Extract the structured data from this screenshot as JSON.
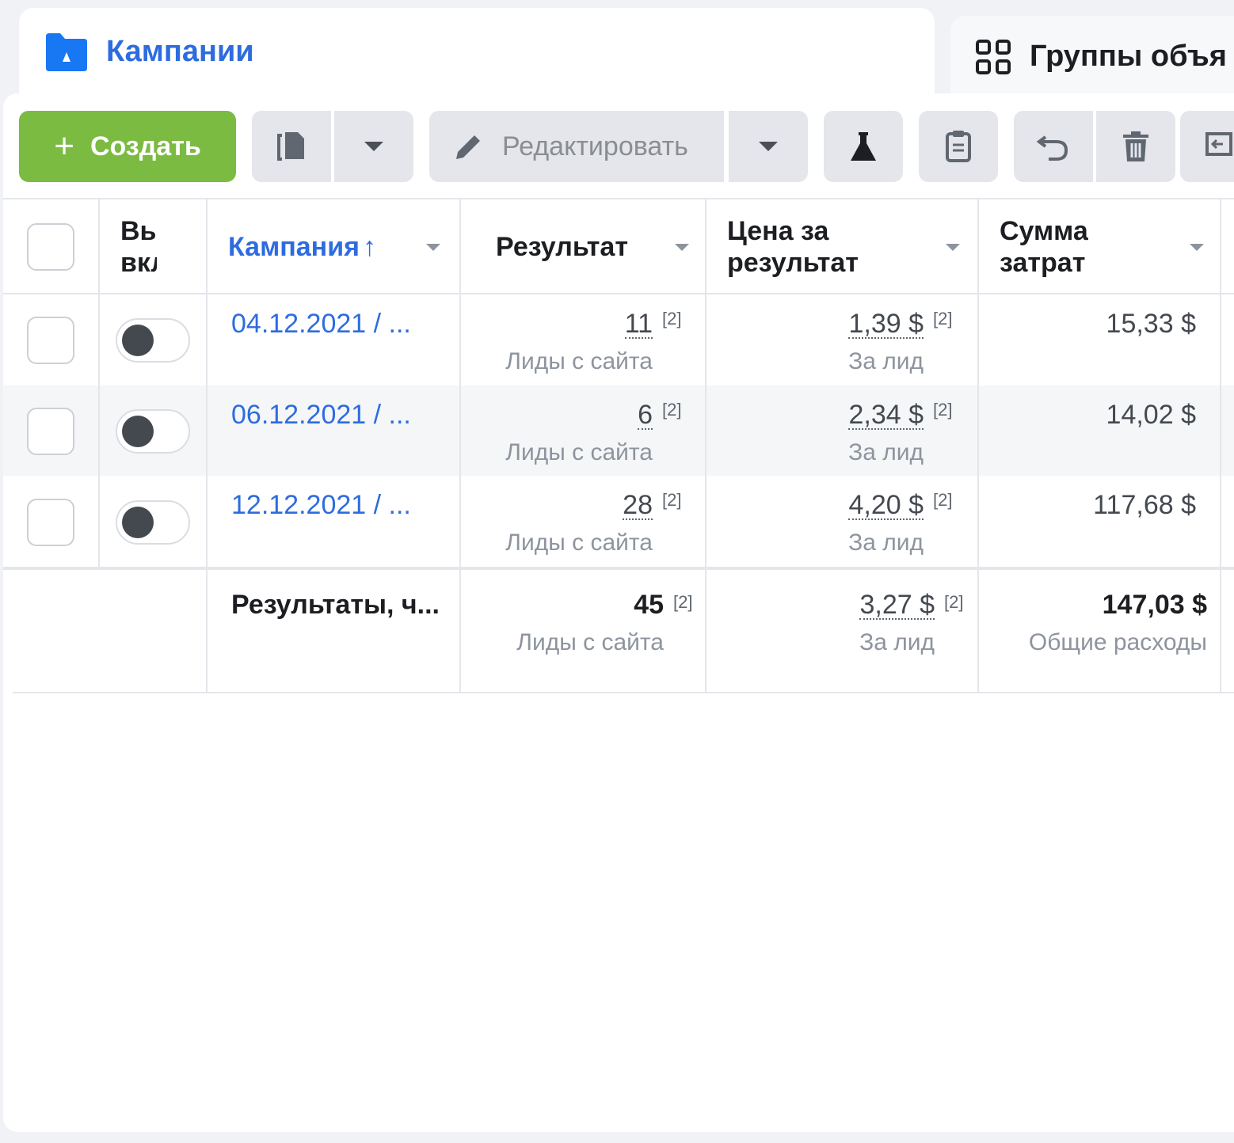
{
  "tabs": {
    "campaigns": "Кампании",
    "ad_sets": "Группы объя"
  },
  "toolbar": {
    "create_label": "Создать",
    "create_plus": "+",
    "edit_label": "Редактировать"
  },
  "table": {
    "headers": {
      "onoff_line1": "Вы",
      "onoff_line2": "вкл",
      "campaign": "Кампания",
      "campaign_sort": "↑",
      "result": "Результат",
      "cost_line1": "Цена за",
      "cost_line2": "результат",
      "spend_line1": "Сумма",
      "spend_line2": "затрат"
    },
    "rows": [
      {
        "campaign": "04.12.2021 / ...",
        "result": "11",
        "result_note": "[2]",
        "result_type": "Лиды с сайта",
        "cost": "1,39 $",
        "cost_note": "[2]",
        "cost_type": "За лид",
        "spend": "15,33 $",
        "enabled": false
      },
      {
        "campaign": "06.12.2021 / ...",
        "result": "6",
        "result_note": "[2]",
        "result_type": "Лиды с сайта",
        "cost": "2,34 $",
        "cost_note": "[2]",
        "cost_type": "За лид",
        "spend": "14,02 $",
        "enabled": false
      },
      {
        "campaign": "12.12.2021 / ...",
        "result": "28",
        "result_note": "[2]",
        "result_type": "Лиды с сайта",
        "cost": "4,20 $",
        "cost_note": "[2]",
        "cost_type": "За лид",
        "spend": "117,68 $",
        "enabled": false
      }
    ],
    "totals": {
      "label": "Результаты, ч...",
      "result": "45",
      "result_note": "[2]",
      "result_type": "Лиды с сайта",
      "cost": "3,27 $",
      "cost_note": "[2]",
      "cost_type": "За лид",
      "spend": "147,03 $",
      "spend_type": "Общие расходы"
    }
  },
  "colors": {
    "accent": "#2d6cdf",
    "create_button": "#7cbb42",
    "toggle_knob": "#444950"
  },
  "icons": [
    "folder-icon",
    "grid-icon",
    "duplicate-icon",
    "pencil-icon",
    "flask-icon",
    "clipboard-icon",
    "undo-icon",
    "trash-icon",
    "export-icon"
  ]
}
